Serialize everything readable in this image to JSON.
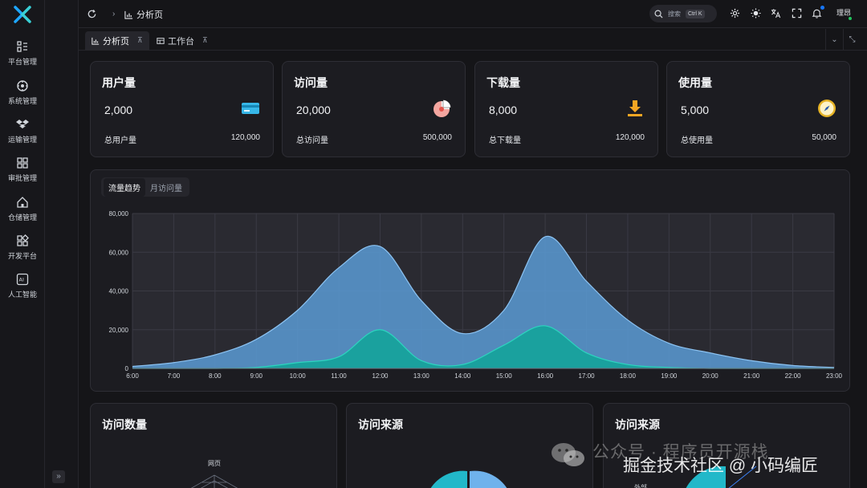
{
  "sidebar": {
    "items": [
      {
        "label": "平台管理",
        "icon": "platform-icon"
      },
      {
        "label": "系统管理",
        "icon": "system-icon"
      },
      {
        "label": "运输管理",
        "icon": "dropbox-icon"
      },
      {
        "label": "审批管理",
        "icon": "grid-icon"
      },
      {
        "label": "仓储管理",
        "icon": "home-icon"
      },
      {
        "label": "开发平台",
        "icon": "apps-icon"
      },
      {
        "label": "人工智能",
        "icon": "ai-icon"
      }
    ],
    "collapse_label": "»"
  },
  "header": {
    "breadcrumb": "分析页",
    "search_placeholder": "搜索",
    "search_shortcut": "Ctrl K",
    "user_name": "理昂"
  },
  "tabs": [
    {
      "label": "分析页",
      "active": true
    },
    {
      "label": "工作台",
      "active": false
    }
  ],
  "stats": [
    {
      "title": "用户量",
      "value": "2,000",
      "total_label": "总用户量",
      "total_value": "120,000",
      "icon": "card-icon"
    },
    {
      "title": "访问量",
      "value": "20,000",
      "total_label": "总访问量",
      "total_value": "500,000",
      "icon": "pie-icon"
    },
    {
      "title": "下载量",
      "value": "8,000",
      "total_label": "总下载量",
      "total_value": "120,000",
      "icon": "download-icon"
    },
    {
      "title": "使用量",
      "value": "5,000",
      "total_label": "总使用量",
      "total_value": "50,000",
      "icon": "compass-icon"
    }
  ],
  "chart_tabs": [
    "流量趋势",
    "月访问量"
  ],
  "chart_data": {
    "type": "area",
    "x": [
      "6:00",
      "7:00",
      "8:00",
      "9:00",
      "10:00",
      "11:00",
      "12:00",
      "13:00",
      "14:00",
      "15:00",
      "16:00",
      "17:00",
      "18:00",
      "19:00",
      "20:00",
      "21:00",
      "22:00",
      "23:00"
    ],
    "ylim": [
      0,
      80000
    ],
    "yticks": [
      0,
      20000,
      40000,
      60000,
      80000
    ],
    "ytick_labels": [
      "0",
      "20,000",
      "40,000",
      "60,000",
      "80,000"
    ],
    "grid": true,
    "series": [
      {
        "values": [
          1000,
          3000,
          7000,
          15000,
          30000,
          52000,
          63000,
          35000,
          18000,
          30000,
          68000,
          45000,
          25000,
          13000,
          8000,
          4000,
          1500,
          500
        ],
        "color": "#5b9bd5"
      },
      {
        "values": [
          0,
          0,
          0,
          500,
          3000,
          6000,
          20000,
          4000,
          2000,
          12000,
          22000,
          8000,
          2000,
          500,
          0,
          0,
          0,
          0
        ],
        "color": "#14a39a"
      }
    ]
  },
  "bottom_cards": [
    {
      "title": "访问数量",
      "radar_label": "网页"
    },
    {
      "title": "访问来源"
    },
    {
      "title": "访问来源",
      "partial_label": "外部"
    }
  ],
  "watermark": {
    "line1": "公众号 · 程序员开源栈",
    "line2": "掘金技术社区 @ 小码编匠"
  }
}
